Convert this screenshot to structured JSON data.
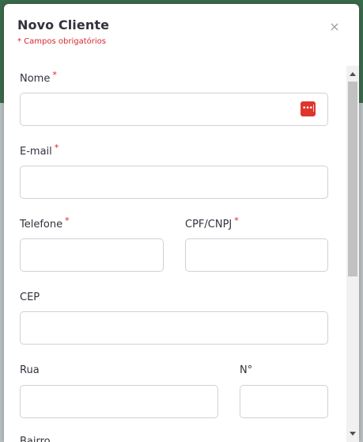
{
  "modal": {
    "title": "Novo Cliente",
    "subtitle": "* Campos obrigatórios",
    "close_glyph": "×"
  },
  "form": {
    "required_mark": "*",
    "nome": {
      "label": "Nome",
      "value": "",
      "required": true,
      "autofill_icon": "password-manager-icon"
    },
    "email": {
      "label": "E-mail",
      "value": "",
      "required": true
    },
    "telefone": {
      "label": "Telefone",
      "value": "",
      "required": true
    },
    "cpf_cnpj": {
      "label": "CPF/CNPJ",
      "value": "",
      "required": true
    },
    "cep": {
      "label": "CEP",
      "value": "",
      "required": false
    },
    "rua": {
      "label": "Rua",
      "value": "",
      "required": false
    },
    "numero": {
      "label": "N°",
      "value": "",
      "required": false
    },
    "bairro": {
      "label": "Bairro",
      "required": false
    }
  },
  "pw_icon_glyph": "•••|",
  "colors": {
    "required": "#d7262d",
    "text": "#33323d",
    "input_border": "#cfd1d5",
    "password_icon": "#e0342e"
  }
}
